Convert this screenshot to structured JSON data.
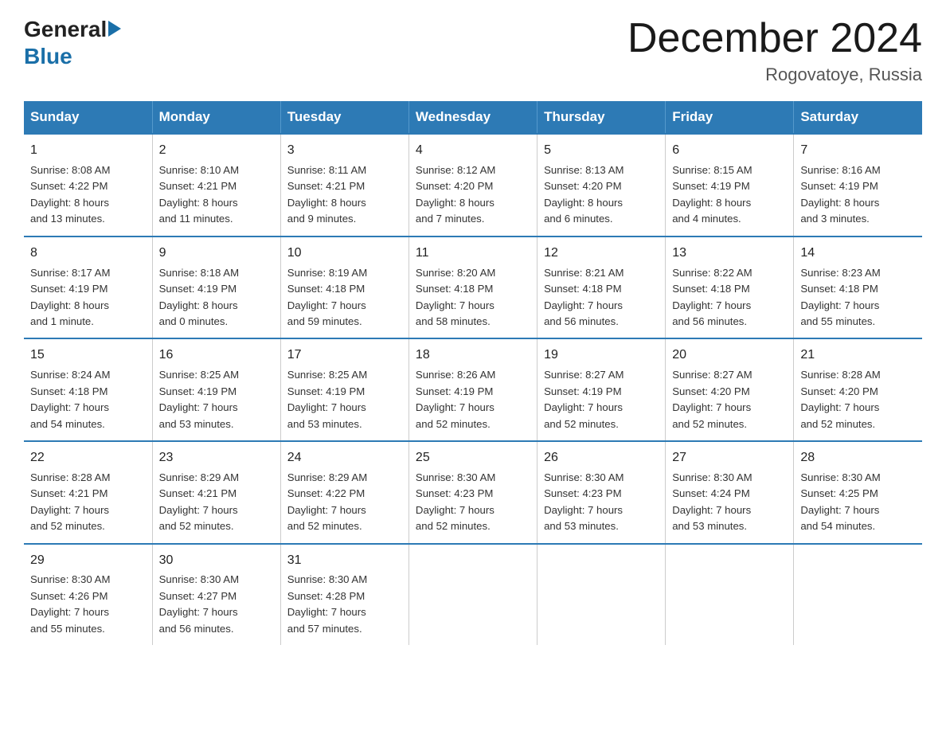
{
  "header": {
    "logo_general": "General",
    "logo_blue": "Blue",
    "month_year": "December 2024",
    "location": "Rogovatoye, Russia"
  },
  "weekdays": [
    "Sunday",
    "Monday",
    "Tuesday",
    "Wednesday",
    "Thursday",
    "Friday",
    "Saturday"
  ],
  "weeks": [
    [
      {
        "day": "1",
        "info": "Sunrise: 8:08 AM\nSunset: 4:22 PM\nDaylight: 8 hours\nand 13 minutes."
      },
      {
        "day": "2",
        "info": "Sunrise: 8:10 AM\nSunset: 4:21 PM\nDaylight: 8 hours\nand 11 minutes."
      },
      {
        "day": "3",
        "info": "Sunrise: 8:11 AM\nSunset: 4:21 PM\nDaylight: 8 hours\nand 9 minutes."
      },
      {
        "day": "4",
        "info": "Sunrise: 8:12 AM\nSunset: 4:20 PM\nDaylight: 8 hours\nand 7 minutes."
      },
      {
        "day": "5",
        "info": "Sunrise: 8:13 AM\nSunset: 4:20 PM\nDaylight: 8 hours\nand 6 minutes."
      },
      {
        "day": "6",
        "info": "Sunrise: 8:15 AM\nSunset: 4:19 PM\nDaylight: 8 hours\nand 4 minutes."
      },
      {
        "day": "7",
        "info": "Sunrise: 8:16 AM\nSunset: 4:19 PM\nDaylight: 8 hours\nand 3 minutes."
      }
    ],
    [
      {
        "day": "8",
        "info": "Sunrise: 8:17 AM\nSunset: 4:19 PM\nDaylight: 8 hours\nand 1 minute."
      },
      {
        "day": "9",
        "info": "Sunrise: 8:18 AM\nSunset: 4:19 PM\nDaylight: 8 hours\nand 0 minutes."
      },
      {
        "day": "10",
        "info": "Sunrise: 8:19 AM\nSunset: 4:18 PM\nDaylight: 7 hours\nand 59 minutes."
      },
      {
        "day": "11",
        "info": "Sunrise: 8:20 AM\nSunset: 4:18 PM\nDaylight: 7 hours\nand 58 minutes."
      },
      {
        "day": "12",
        "info": "Sunrise: 8:21 AM\nSunset: 4:18 PM\nDaylight: 7 hours\nand 56 minutes."
      },
      {
        "day": "13",
        "info": "Sunrise: 8:22 AM\nSunset: 4:18 PM\nDaylight: 7 hours\nand 56 minutes."
      },
      {
        "day": "14",
        "info": "Sunrise: 8:23 AM\nSunset: 4:18 PM\nDaylight: 7 hours\nand 55 minutes."
      }
    ],
    [
      {
        "day": "15",
        "info": "Sunrise: 8:24 AM\nSunset: 4:18 PM\nDaylight: 7 hours\nand 54 minutes."
      },
      {
        "day": "16",
        "info": "Sunrise: 8:25 AM\nSunset: 4:19 PM\nDaylight: 7 hours\nand 53 minutes."
      },
      {
        "day": "17",
        "info": "Sunrise: 8:25 AM\nSunset: 4:19 PM\nDaylight: 7 hours\nand 53 minutes."
      },
      {
        "day": "18",
        "info": "Sunrise: 8:26 AM\nSunset: 4:19 PM\nDaylight: 7 hours\nand 52 minutes."
      },
      {
        "day": "19",
        "info": "Sunrise: 8:27 AM\nSunset: 4:19 PM\nDaylight: 7 hours\nand 52 minutes."
      },
      {
        "day": "20",
        "info": "Sunrise: 8:27 AM\nSunset: 4:20 PM\nDaylight: 7 hours\nand 52 minutes."
      },
      {
        "day": "21",
        "info": "Sunrise: 8:28 AM\nSunset: 4:20 PM\nDaylight: 7 hours\nand 52 minutes."
      }
    ],
    [
      {
        "day": "22",
        "info": "Sunrise: 8:28 AM\nSunset: 4:21 PM\nDaylight: 7 hours\nand 52 minutes."
      },
      {
        "day": "23",
        "info": "Sunrise: 8:29 AM\nSunset: 4:21 PM\nDaylight: 7 hours\nand 52 minutes."
      },
      {
        "day": "24",
        "info": "Sunrise: 8:29 AM\nSunset: 4:22 PM\nDaylight: 7 hours\nand 52 minutes."
      },
      {
        "day": "25",
        "info": "Sunrise: 8:30 AM\nSunset: 4:23 PM\nDaylight: 7 hours\nand 52 minutes."
      },
      {
        "day": "26",
        "info": "Sunrise: 8:30 AM\nSunset: 4:23 PM\nDaylight: 7 hours\nand 53 minutes."
      },
      {
        "day": "27",
        "info": "Sunrise: 8:30 AM\nSunset: 4:24 PM\nDaylight: 7 hours\nand 53 minutes."
      },
      {
        "day": "28",
        "info": "Sunrise: 8:30 AM\nSunset: 4:25 PM\nDaylight: 7 hours\nand 54 minutes."
      }
    ],
    [
      {
        "day": "29",
        "info": "Sunrise: 8:30 AM\nSunset: 4:26 PM\nDaylight: 7 hours\nand 55 minutes."
      },
      {
        "day": "30",
        "info": "Sunrise: 8:30 AM\nSunset: 4:27 PM\nDaylight: 7 hours\nand 56 minutes."
      },
      {
        "day": "31",
        "info": "Sunrise: 8:30 AM\nSunset: 4:28 PM\nDaylight: 7 hours\nand 57 minutes."
      },
      {
        "day": "",
        "info": ""
      },
      {
        "day": "",
        "info": ""
      },
      {
        "day": "",
        "info": ""
      },
      {
        "day": "",
        "info": ""
      }
    ]
  ]
}
